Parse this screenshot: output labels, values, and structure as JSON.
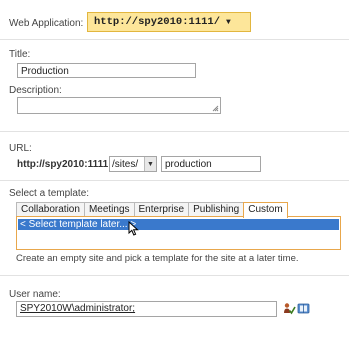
{
  "web_application": {
    "label": "Web Application:",
    "value": "http://spy2010:1111/"
  },
  "title_field": {
    "label": "Title:",
    "value": "Production"
  },
  "description_field": {
    "label": "Description:",
    "value": ""
  },
  "url_section": {
    "label": "URL:",
    "prefix": "http://spy2010:1111",
    "path_selected": "/sites/",
    "site_name": "production"
  },
  "template_section": {
    "label": "Select a template:",
    "tabs": [
      "Collaboration",
      "Meetings",
      "Enterprise",
      "Publishing",
      "Custom"
    ],
    "active_tab": "Custom",
    "items": [
      "< Select template later... >"
    ],
    "selected_item": "< Select template later... >",
    "hint": "Create an empty site and pick a template for the site at a later time."
  },
  "user_section": {
    "label": "User name:",
    "value": "SPY2010W\\administrator;"
  },
  "colors": {
    "accent_border": "#e8a74c",
    "webapp_button_bg": "#fde69a",
    "selection_bg": "#3a79cc"
  },
  "icons": [
    "chevron-down-icon",
    "resize-grip-icon",
    "check-names-icon",
    "address-book-icon",
    "mouse-cursor-icon"
  ]
}
